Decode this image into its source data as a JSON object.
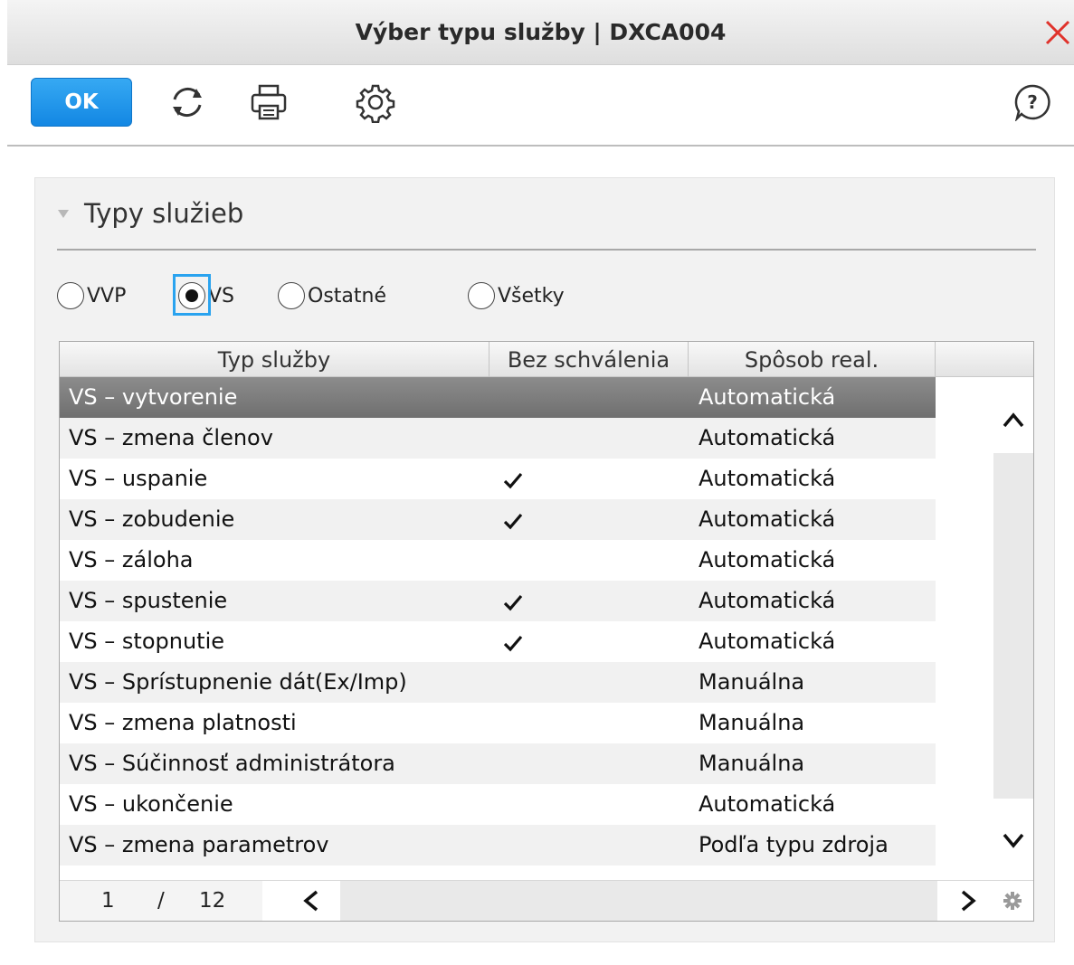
{
  "window": {
    "title": "Výber typu služby | DXCA004"
  },
  "toolbar": {
    "ok_label": "OK",
    "icons": [
      "refresh-icon",
      "print-icon",
      "settings-gear-icon",
      "help-icon"
    ]
  },
  "panel": {
    "title": "Typy služieb",
    "radios": [
      {
        "label": "VVP",
        "checked": false
      },
      {
        "label": "VS",
        "checked": true
      },
      {
        "label": "Ostatné",
        "checked": false
      },
      {
        "label": "Všetky",
        "checked": false
      }
    ]
  },
  "grid": {
    "columns": [
      "Typ služby",
      "Bez schválenia",
      "Spôsob real."
    ],
    "rows": [
      {
        "type": "VS – vytvorenie",
        "no_approval": false,
        "method": "Automatická",
        "selected": true
      },
      {
        "type": "VS – zmena členov",
        "no_approval": false,
        "method": "Automatická"
      },
      {
        "type": "VS – uspanie",
        "no_approval": true,
        "method": "Automatická"
      },
      {
        "type": "VS – zobudenie",
        "no_approval": true,
        "method": "Automatická"
      },
      {
        "type": "VS – záloha",
        "no_approval": false,
        "method": "Automatická"
      },
      {
        "type": "VS – spustenie",
        "no_approval": true,
        "method": "Automatická"
      },
      {
        "type": "VS – stopnutie",
        "no_approval": true,
        "method": "Automatická"
      },
      {
        "type": "VS – Sprístupnenie dát(Ex/Imp)",
        "no_approval": false,
        "method": "Manuálna"
      },
      {
        "type": "VS – zmena platnosti",
        "no_approval": false,
        "method": "Manuálna"
      },
      {
        "type": "VS – Súčinnosť administrátora",
        "no_approval": false,
        "method": "Manuálna"
      },
      {
        "type": "VS – ukončenie",
        "no_approval": false,
        "method": "Automatická"
      },
      {
        "type": "VS – zmena parametrov",
        "no_approval": false,
        "method": "Podľa typu zdroja"
      }
    ],
    "pager": {
      "current": "1",
      "separator": "/",
      "total": "12"
    }
  },
  "colors": {
    "accent": "#1a8fe6",
    "close": "#e0322b",
    "selected_row": "#7d7d7d",
    "focus": "#2aa3ef"
  }
}
